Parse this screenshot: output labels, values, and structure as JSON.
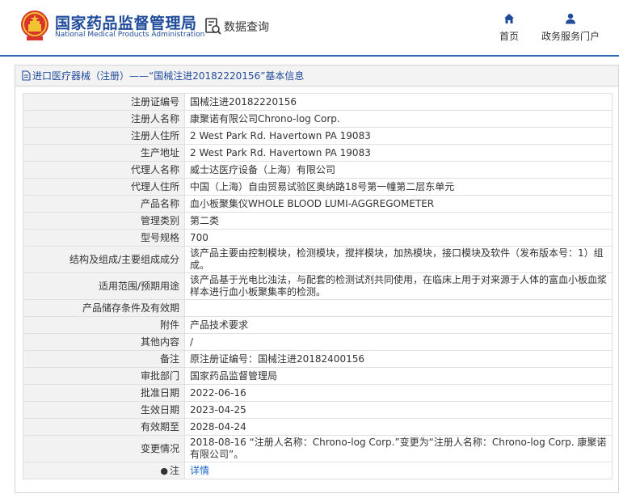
{
  "header": {
    "org_cn": "国家药品监督管理局",
    "org_en": "National Medical Products Administration",
    "data_query": "数据查询",
    "nav_home": "首页",
    "nav_gov": "政务服务门户"
  },
  "panel": {
    "title": "进口医疗器械（注册）——“国械注进20182220156”基本信息"
  },
  "rows": [
    {
      "label": "注册证编号",
      "value": "国械注进20182220156"
    },
    {
      "label": "注册人名称",
      "value": "康聚诺有限公司Chrono-log Corp."
    },
    {
      "label": "注册人住所",
      "value": "2 West Park Rd. Havertown PA 19083"
    },
    {
      "label": "生产地址",
      "value": "2 West Park Rd. Havertown PA 19083"
    },
    {
      "label": "代理人名称",
      "value": "威士达医疗设备（上海）有限公司"
    },
    {
      "label": "代理人住所",
      "value": "中国（上海）自由贸易试验区奥纳路18号第一幢第二层东单元"
    },
    {
      "label": "产品名称",
      "value": "血小板聚集仪WHOLE BLOOD LUMI-AGGREGOMETER"
    },
    {
      "label": "管理类别",
      "value": "第二类"
    },
    {
      "label": "型号规格",
      "value": "700"
    },
    {
      "label": "结构及组成/主要组成成分",
      "value": "该产品主要由控制模块，检测模块，搅拌模块，加热模块，接口模块及软件（发布版本号：1）组成。"
    },
    {
      "label": "适用范围/预期用途",
      "value": "该产品基于光电比浊法，与配套的检测试剂共同使用，在临床上用于对来源于人体的富血小板血浆样本进行血小板聚集率的检测。"
    },
    {
      "label": "产品储存条件及有效期",
      "value": ""
    },
    {
      "label": "附件",
      "value": "产品技术要求"
    },
    {
      "label": "其他内容",
      "value": "/"
    },
    {
      "label": "备注",
      "value": "原注册证编号：国械注进20182400156"
    },
    {
      "label": "审批部门",
      "value": "国家药品监督管理局"
    },
    {
      "label": "批准日期",
      "value": "2022-06-16"
    },
    {
      "label": "生效日期",
      "value": "2023-04-25"
    },
    {
      "label": "有效期至",
      "value": "2028-04-24"
    },
    {
      "label": "变更情况",
      "value": "2018-08-16 “注册人名称：Chrono-log Corp.”变更为“注册人名称：Chrono-log Corp. 康聚诺有限公司”。"
    }
  ],
  "note_row": {
    "label": "注",
    "link": "详情"
  },
  "colors": {
    "brand": "#1f4b9a",
    "link": "#1a66c9",
    "label_bg": "#f2f2f2"
  }
}
